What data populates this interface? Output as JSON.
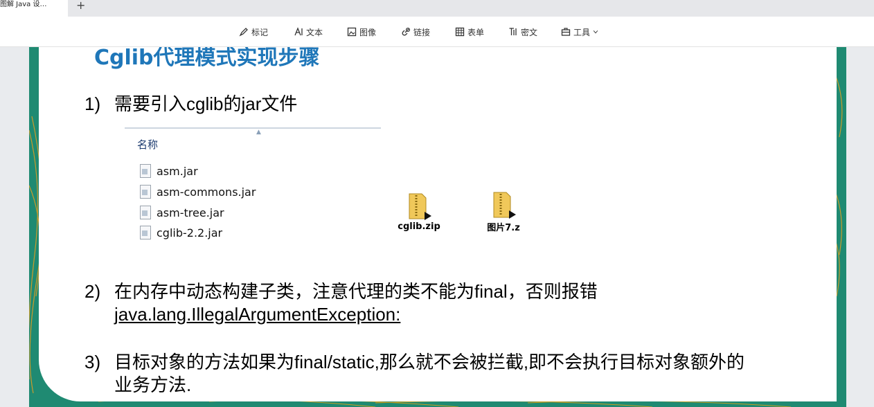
{
  "tab": {
    "title": "图解 Java 设…",
    "new_tab": "+"
  },
  "toolbar": {
    "items": [
      {
        "label": "标记",
        "icon": "marker-icon"
      },
      {
        "label": "文本",
        "icon": "text-icon"
      },
      {
        "label": "图像",
        "icon": "image-icon"
      },
      {
        "label": "链接",
        "icon": "link-icon"
      },
      {
        "label": "表单",
        "icon": "table-icon"
      },
      {
        "label": "密文",
        "icon": "redact-icon"
      },
      {
        "label": "工具",
        "icon": "toolbox-icon"
      }
    ]
  },
  "slide": {
    "heading": "Cglib代理模式实现步骤",
    "item1": {
      "num": "1)",
      "text": "需要引入cglib的jar文件"
    },
    "explorer": {
      "header": "名称",
      "files": [
        "asm.jar",
        "asm-commons.jar",
        "asm-tree.jar",
        "cglib-2.2.jar"
      ]
    },
    "zips": [
      "cglib.zip",
      "图片7.z"
    ],
    "item2": {
      "num": "2)",
      "line1": "在内存中动态构建子类，注意代理的类不能为final，否则报错",
      "line2": "java.lang.IllegalArgumentException:"
    },
    "item3": {
      "num": "3)",
      "line1": "目标对象的方法如果为final/static,那么就不会被拦截,即不会执行目标对象额外的",
      "line2": "业务方法."
    }
  },
  "colors": {
    "heading": "#1f77b9",
    "slide_bg": "#1f8a72",
    "accent": "#e8a020"
  }
}
